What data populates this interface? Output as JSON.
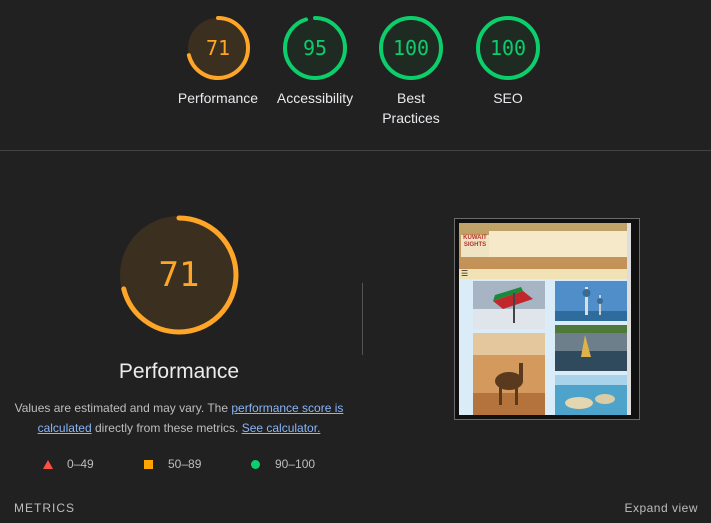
{
  "categories": [
    {
      "label": "Performance",
      "score": "71",
      "value": 71,
      "color": "#ffa629",
      "bg": "#3b3020"
    },
    {
      "label": "Accessibility",
      "score": "95",
      "value": 95,
      "color": "#0cce6b",
      "bg": "#1e2a22"
    },
    {
      "label": "Best Practices",
      "score": "100",
      "value": 100,
      "color": "#0cce6b",
      "bg": "#1e2a22"
    },
    {
      "label": "SEO",
      "score": "100",
      "value": 100,
      "color": "#0cce6b",
      "bg": "#1e2a22"
    }
  ],
  "main": {
    "score": "71",
    "value": 71,
    "title": "Performance",
    "desc_before": "Values are estimated and may vary. The ",
    "link1": "performance score is calculated",
    "desc_middle": " directly from these metrics. ",
    "link2": "See calculator."
  },
  "legend": [
    {
      "range": "0–49",
      "shape": "triangle",
      "color": "#ff4e42"
    },
    {
      "range": "50–89",
      "shape": "square",
      "color": "#ffa400"
    },
    {
      "range": "90–100",
      "shape": "circle",
      "color": "#0cce6b"
    }
  ],
  "screenshot": {
    "logo": "KUWAIT SIGHTS",
    "menu_icon": "☰"
  },
  "footer": {
    "metrics_label": "METRICS",
    "expand_label": "Expand view"
  }
}
